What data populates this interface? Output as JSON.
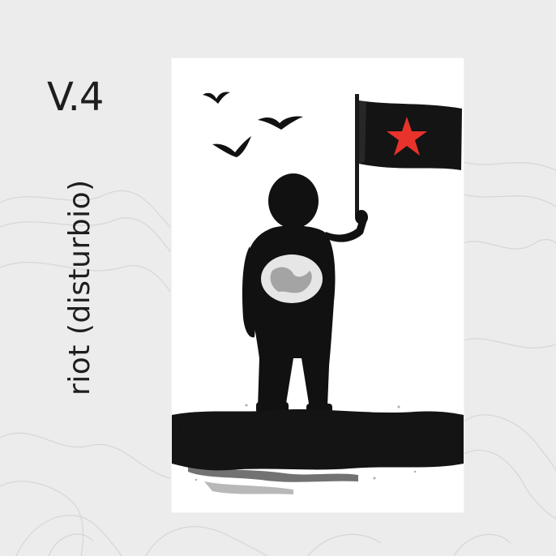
{
  "version_label": "V.4",
  "title_text": "riot (disturbio)",
  "colors": {
    "background": "#ececec",
    "poster": "#ffffff",
    "ink": "#111111",
    "star": "#e8332c"
  },
  "artwork": {
    "icons": [
      "bird-icon",
      "flag-icon",
      "star-icon",
      "globe-icon",
      "child-silhouette"
    ]
  }
}
